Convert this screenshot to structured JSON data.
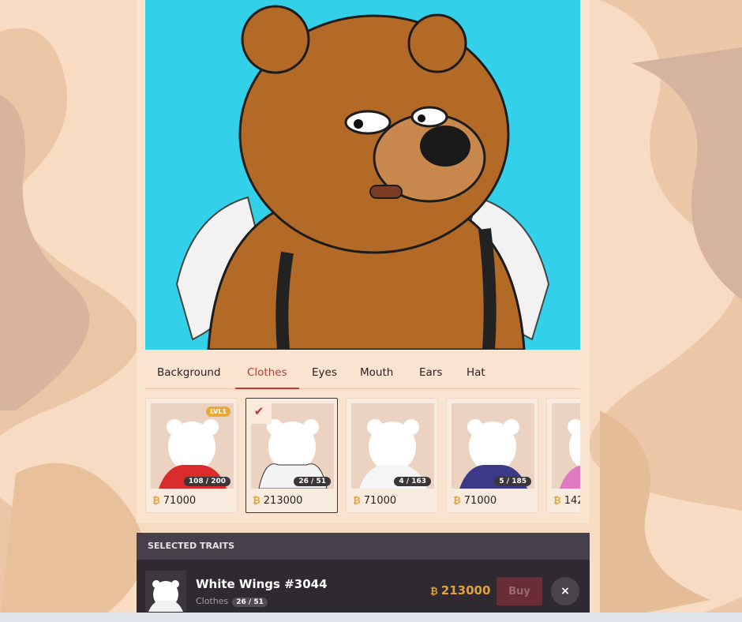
{
  "tabs": [
    "Background",
    "Clothes",
    "Eyes",
    "Mouth",
    "Ears",
    "Hat"
  ],
  "active_tab": "Clothes",
  "cards": [
    {
      "badge": "LVL1",
      "count": "108 / 200",
      "price": "71000",
      "selected": false
    },
    {
      "badge": "",
      "count": "26 / 51",
      "price": "213000",
      "selected": true
    },
    {
      "badge": "",
      "count": "4 / 163",
      "price": "71000",
      "selected": false
    },
    {
      "badge": "",
      "count": "5 / 185",
      "price": "71000",
      "selected": false
    },
    {
      "badge": "",
      "count": "",
      "price": "142",
      "selected": false
    }
  ],
  "selected_traits": {
    "header": "SELECTED TRAITS",
    "item_name": "White Wings #3044",
    "item_category": "Clothes",
    "item_count": "26 / 51",
    "item_price": "213000",
    "buy_label": "Buy",
    "close_symbol": "×"
  },
  "icons": {
    "coin": "coin-icon",
    "check": "check-icon",
    "close": "close-icon"
  },
  "colors": {
    "accent": "#c23a3a",
    "hero_bg": "#33d1e9",
    "gold": "#e3a13a"
  }
}
